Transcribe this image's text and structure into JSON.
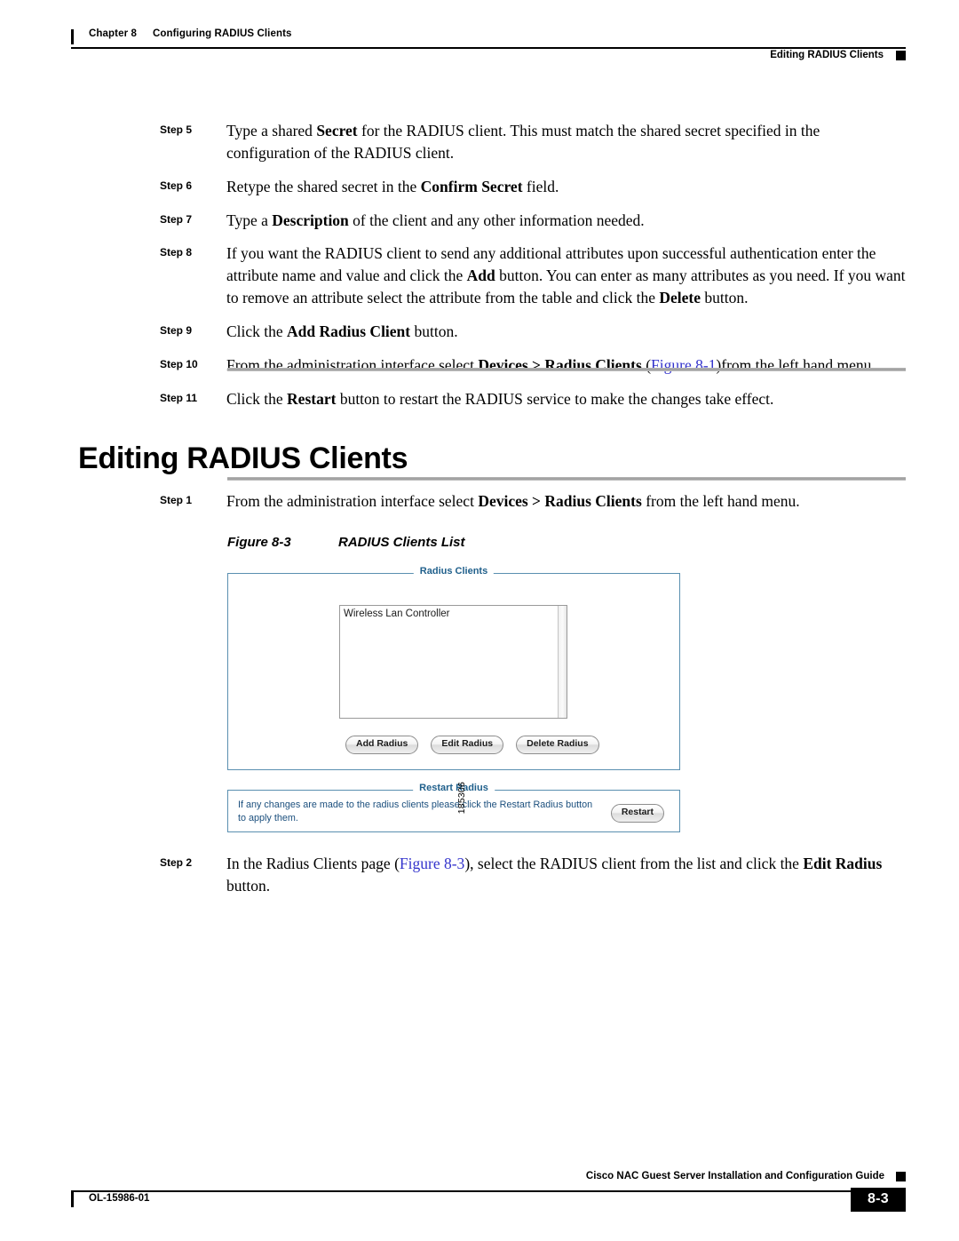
{
  "header": {
    "chapter_label": "Chapter 8",
    "chapter_title": "Configuring RADIUS Clients",
    "section_right": "Editing RADIUS Clients"
  },
  "steps_top": [
    {
      "label": "Step 5",
      "parts": [
        {
          "t": "Type a shared ",
          "b": false
        },
        {
          "t": "Secret",
          "b": true
        },
        {
          "t": " for the RADIUS client. This must match the shared secret specified in the configuration of the RADIUS client.",
          "b": false
        }
      ]
    },
    {
      "label": "Step 6",
      "parts": [
        {
          "t": "Retype the shared secret in the ",
          "b": false
        },
        {
          "t": "Confirm Secret",
          "b": true
        },
        {
          "t": " field.",
          "b": false
        }
      ]
    },
    {
      "label": "Step 7",
      "parts": [
        {
          "t": "Type a ",
          "b": false
        },
        {
          "t": "Description",
          "b": true
        },
        {
          "t": " of the client and any other information needed.",
          "b": false
        }
      ]
    },
    {
      "label": "Step 8",
      "parts": [
        {
          "t": "If you want the RADIUS client to send any additional attributes upon successful authentication enter the attribute name and value and click the ",
          "b": false
        },
        {
          "t": "Add",
          "b": true
        },
        {
          "t": " button. You can enter as many attributes as you need. If you want to remove an attribute select the attribute from the table and click the ",
          "b": false
        },
        {
          "t": "Delete",
          "b": true
        },
        {
          "t": " button.",
          "b": false
        }
      ]
    },
    {
      "label": "Step 9",
      "parts": [
        {
          "t": "Click the ",
          "b": false
        },
        {
          "t": "Add Radius Client",
          "b": true
        },
        {
          "t": " button.",
          "b": false
        }
      ]
    },
    {
      "label": "Step 10",
      "parts": [
        {
          "t": "From the administration interface select ",
          "b": false
        },
        {
          "t": "Devices > Radius Clients",
          "b": true
        },
        {
          "t": " (",
          "b": false
        },
        {
          "t": "Figure 8-1",
          "b": false,
          "x": true
        },
        {
          "t": ")from the left hand menu.",
          "b": false
        }
      ]
    },
    {
      "label": "Step 11",
      "parts": [
        {
          "t": "Click the ",
          "b": false
        },
        {
          "t": "Restart",
          "b": true
        },
        {
          "t": " button to restart the RADIUS service to make the changes take effect.",
          "b": false
        }
      ]
    }
  ],
  "section": {
    "heading": "Editing RADIUS Clients"
  },
  "steps_mid": [
    {
      "label": "Step 1",
      "parts": [
        {
          "t": "From the administration interface select ",
          "b": false
        },
        {
          "t": "Devices > Radius Clients",
          "b": true
        },
        {
          "t": " from the left hand menu.",
          "b": false
        }
      ]
    }
  ],
  "figure": {
    "number": "Figure 8-3",
    "title": "RADIUS Clients List",
    "graphic_id": "185306",
    "clients_panel": {
      "legend": "Radius Clients",
      "list_items": [
        "Wireless Lan Controller"
      ],
      "buttons": [
        "Add Radius",
        "Edit Radius",
        "Delete Radius"
      ]
    },
    "restart_panel": {
      "legend": "Restart Radius",
      "text": "If any changes are made to the radius clients please click the Restart Radius button to apply them.",
      "button": "Restart"
    }
  },
  "steps_bottom": [
    {
      "label": "Step 2",
      "parts": [
        {
          "t": "In the Radius Clients page (",
          "b": false
        },
        {
          "t": "Figure 8-3",
          "b": false,
          "x": true
        },
        {
          "t": "), select the RADIUS client from the list and click the ",
          "b": false
        },
        {
          "t": "Edit Radius",
          "b": true
        },
        {
          "t": " button.",
          "b": false
        }
      ]
    }
  ],
  "footer": {
    "guide_title": "Cisco NAC Guest Server Installation and Configuration Guide",
    "doc_id": "OL-15986-01",
    "page_number": "8-3"
  },
  "colors": {
    "panel_border": "#5a8fb0",
    "legend_text": "#1f5f8b",
    "restart_text": "#1b4f7d",
    "xref_link": "#3333cc",
    "rule_gray": "#9a9a9a"
  }
}
